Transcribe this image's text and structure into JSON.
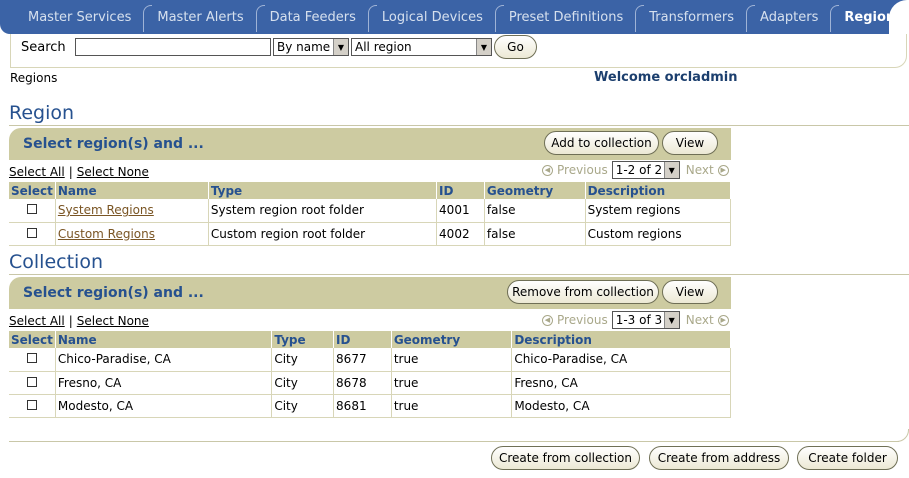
{
  "tabs": [
    "Master Services",
    "Master Alerts",
    "Data Feeders",
    "Logical Devices",
    "Preset Definitions",
    "Transformers",
    "Adapters",
    "Regions"
  ],
  "search": {
    "label": "Search",
    "value": "",
    "by": "By name",
    "scope": "All region",
    "go": "Go"
  },
  "breadcrumb": "Regions",
  "welcome": "Welcome orcladmin",
  "region": {
    "heading": "Region",
    "band_title": "Select region(s) and ...",
    "add_btn": "Add to collection",
    "view_btn": "View",
    "select_all": "Select All",
    "select_none": "Select None",
    "prev": "Previous",
    "range": "1-2 of 2",
    "next": "Next",
    "columns": [
      "Select",
      "Name",
      "Type",
      "ID",
      "Geometry",
      "Description"
    ],
    "rows": [
      {
        "name": "System Regions",
        "type": "System region root folder",
        "id": "4001",
        "geometry": "false",
        "description": "System regions"
      },
      {
        "name": "Custom Regions",
        "type": "Custom region root folder",
        "id": "4002",
        "geometry": "false",
        "description": "Custom regions"
      }
    ]
  },
  "collection": {
    "heading": "Collection",
    "band_title": "Select region(s) and ...",
    "remove_btn": "Remove from collection",
    "view_btn": "View",
    "select_all": "Select All",
    "select_none": "Select None",
    "prev": "Previous",
    "range": "1-3 of 3",
    "next": "Next",
    "columns": [
      "Select",
      "Name",
      "Type",
      "ID",
      "Geometry",
      "Description"
    ],
    "rows": [
      {
        "name": "Chico-Paradise, CA",
        "type": "City",
        "id": "8677",
        "geometry": "true",
        "description": "Chico-Paradise, CA"
      },
      {
        "name": "Fresno, CA",
        "type": "City",
        "id": "8678",
        "geometry": "true",
        "description": "Fresno, CA"
      },
      {
        "name": "Modesto, CA",
        "type": "City",
        "id": "8681",
        "geometry": "true",
        "description": "Modesto, CA"
      }
    ]
  },
  "footer": {
    "create_collection": "Create from collection",
    "create_address": "Create from address",
    "create_folder": "Create folder"
  },
  "colors": {
    "tab_bar": "#3b63a6",
    "band": "#cdcba1",
    "heading": "#26518f",
    "link": "#7a5524"
  }
}
